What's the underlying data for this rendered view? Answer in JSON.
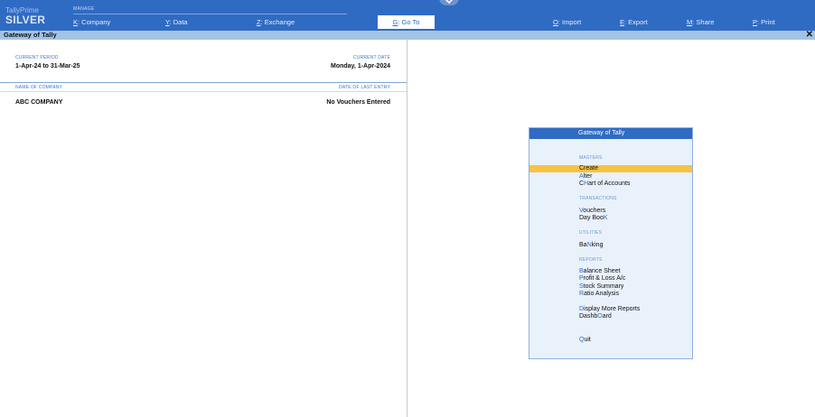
{
  "brand": {
    "top": "TallyPrime",
    "bottom": "SILVER"
  },
  "manage_label": "MANAGE",
  "menu": [
    {
      "key": "K",
      "label": ": Company"
    },
    {
      "key": "Y",
      "label": ": Data"
    },
    {
      "key": "Z",
      "label": ": Exchange"
    },
    {
      "key": "G",
      "label": ": Go To"
    },
    {
      "key": "O",
      "label": ": Import"
    },
    {
      "key": "E",
      "label": ": Export"
    },
    {
      "key": "M",
      "label": ": Share"
    },
    {
      "key": "P",
      "label": ": Print"
    }
  ],
  "title": "Gateway of Tally",
  "close_glyph": "✕",
  "left": {
    "current_period_label": "CURRENT PERIOD",
    "current_period": "1-Apr-24 to 31-Mar-25",
    "current_date_label": "CURRENT DATE",
    "current_date": "Monday, 1-Apr-2024",
    "company_label": "NAME OF COMPANY",
    "last_entry_label": "DATE OF LAST ENTRY",
    "company_name": "ABC COMPANY",
    "last_entry": "No Vouchers Entered"
  },
  "gateway": {
    "header": "Gateway of Tally",
    "masters_label": "MASTERS",
    "transactions_label": "TRANSACTIONS",
    "utilities_label": "UTILITIES",
    "reports_label": "REPORTS",
    "items": {
      "create": "Create",
      "alter_hot": "A",
      "alter_rest": "lter",
      "coa_pre": "C",
      "coa_hot": "H",
      "coa_rest": "art of Accounts",
      "vouchers_hot": "V",
      "vouchers_rest": "ouchers",
      "daybook_pre": "Day Boo",
      "daybook_hot": "K",
      "banking_pre": "Ba",
      "banking_hot": "N",
      "banking_rest": "king",
      "balance_hot": "B",
      "balance_rest": "alance Sheet",
      "pl_hot": "P",
      "pl_rest": "rofit & Loss A/c",
      "stock_hot": "S",
      "stock_rest": "tock Summary",
      "ratio_hot": "R",
      "ratio_rest": "atio Analysis",
      "display_hot": "D",
      "display_rest": "isplay More Reports",
      "dash_pre": "Dashb",
      "dash_hot": "O",
      "dash_rest": "ard",
      "quit_hot": "Q",
      "quit_rest": "uit"
    }
  }
}
